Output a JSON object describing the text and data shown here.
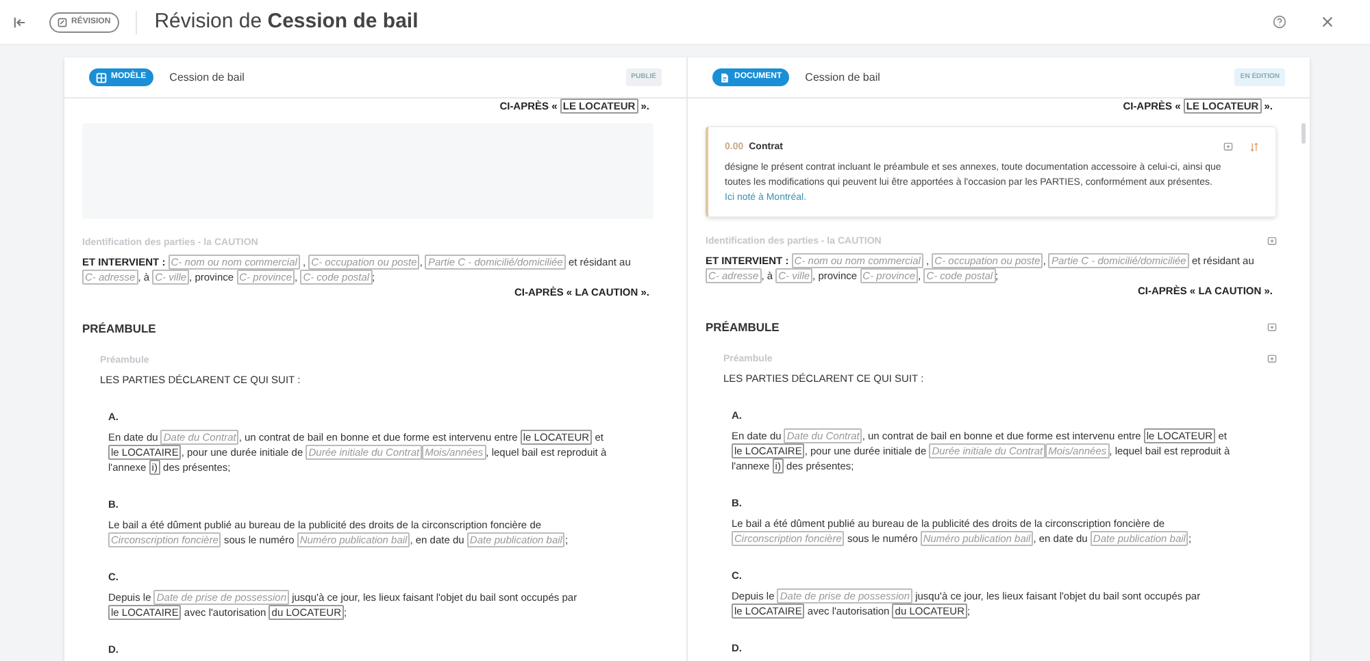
{
  "topbar": {
    "badge": "RÉVISION",
    "title": "Révision de **Cession de bail**"
  },
  "panels": [
    {
      "badge": {
        "label": "MODÈLE",
        "kind": "model"
      },
      "title": "Cession de bail",
      "status": {
        "label": "PUBLIÉ",
        "color": "#eef0f3"
      },
      "blocks": [
        {
          "kind": "closing",
          "parts": [
            {
              "kind": "bold",
              "text": "CI-APRÈS « "
            },
            {
              "kind": "ref",
              "text": "LE LOCATEUR"
            },
            {
              "kind": "bold",
              "text": " »."
            }
          ]
        },
        {
          "kind": "blank"
        },
        {
          "kind": "caption",
          "text": "Identification des parties - la CAUTION"
        },
        {
          "kind": "paragraph",
          "parts": [
            {
              "kind": "bold",
              "text": "ET INTERVIENT : "
            },
            {
              "kind": "field",
              "text": "C- nom ou nom commercial"
            },
            {
              "kind": "text",
              "text": " , "
            },
            {
              "kind": "field",
              "text": "C- occupation ou poste"
            },
            {
              "kind": "text",
              "text": ", "
            },
            {
              "kind": "field",
              "text": "Partie C - domicilié/domiciliée"
            },
            {
              "kind": "text",
              "text": " et résidant au "
            },
            {
              "kind": "field",
              "text": "C- adresse"
            },
            {
              "kind": "text",
              "text": ", à "
            },
            {
              "kind": "field",
              "text": "C- ville"
            },
            {
              "kind": "text",
              "text": ", province "
            },
            {
              "kind": "field",
              "text": "C- province"
            },
            {
              "kind": "text",
              "text": ", "
            },
            {
              "kind": "field",
              "text": "C- code postal"
            },
            {
              "kind": "text",
              "text": ";"
            }
          ]
        },
        {
          "kind": "closing",
          "parts": [
            {
              "kind": "bold",
              "text": "CI-APRÈS « LA CAUTION »."
            }
          ]
        },
        {
          "kind": "heading",
          "text": "PRÉAMBULE"
        },
        {
          "kind": "subcaption",
          "text": "Préambule"
        },
        {
          "kind": "intro",
          "text": "LES PARTIES DÉCLARENT CE QUI SUIT :"
        },
        {
          "kind": "clause_label",
          "text": "A."
        },
        {
          "kind": "clause",
          "parts": [
            {
              "kind": "text",
              "text": "En date du "
            },
            {
              "kind": "field",
              "text": "Date du Contrat"
            },
            {
              "kind": "text",
              "text": ", un contrat de bail en bonne et due forme est intervenu entre "
            },
            {
              "kind": "ref",
              "text": "le LOCATEUR"
            },
            {
              "kind": "text",
              "text": " et "
            },
            {
              "kind": "ref",
              "text": "le LOCATAIRE"
            },
            {
              "kind": "text",
              "text": ", pour une durée initiale de "
            },
            {
              "kind": "field",
              "text": "Durée initiale du Contrat"
            },
            {
              "kind": "field",
              "text": "Mois/années"
            },
            {
              "kind": "text",
              "text": ", lequel bail est reproduit à l'annexe "
            },
            {
              "kind": "ref",
              "text": "i)"
            },
            {
              "kind": "text",
              "text": " des présentes;"
            }
          ]
        },
        {
          "kind": "clause_label",
          "text": "B."
        },
        {
          "kind": "clause",
          "parts": [
            {
              "kind": "text",
              "text": "Le bail a été dûment publié au bureau de la publicité des droits de la circonscription foncière de "
            },
            {
              "kind": "field",
              "text": "Circonscription foncière"
            },
            {
              "kind": "text",
              "text": " sous le numéro "
            },
            {
              "kind": "field",
              "text": "Numéro publication bail"
            },
            {
              "kind": "text",
              "text": ", en date du "
            },
            {
              "kind": "field",
              "text": "Date publication bail"
            },
            {
              "kind": "text",
              "text": ";"
            }
          ]
        },
        {
          "kind": "clause_label",
          "text": "C."
        },
        {
          "kind": "clause",
          "parts": [
            {
              "kind": "text",
              "text": "Depuis le "
            },
            {
              "kind": "field",
              "text": "Date de prise de possession"
            },
            {
              "kind": "text",
              "text": " jusqu'à ce jour, les lieux faisant l'objet du bail sont occupés par "
            },
            {
              "kind": "ref",
              "text": "le LOCATAIRE"
            },
            {
              "kind": "text",
              "text": " avec l'autorisation "
            },
            {
              "kind": "ref",
              "text": "du LOCATEUR"
            },
            {
              "kind": "text",
              "text": ";"
            }
          ]
        },
        {
          "kind": "clause_label",
          "text": "D."
        }
      ]
    },
    {
      "badge": {
        "label": "DOCUMENT",
        "kind": "document"
      },
      "title": "Cession de bail",
      "status": {
        "label": "EN ÉDITION",
        "color": "#e6f3fb"
      },
      "blocks": [
        {
          "kind": "closing",
          "parts": [
            {
              "kind": "bold",
              "text": "CI-APRÈS « "
            },
            {
              "kind": "ref",
              "text": "LE LOCATEUR"
            },
            {
              "kind": "bold",
              "text": " »."
            }
          ]
        },
        {
          "kind": "definition",
          "number": "0.00",
          "title": "Contrat",
          "text": "désigne le présent contrat incluant le préambule et ses annexes, toute documentation accessoire à celui-ci, ainsi que toutes les modifications qui peuvent lui être apportées à l'occasion par les PARTIES, conformément aux présentes. ",
          "link": "Ici noté à Montréal."
        },
        {
          "kind": "caption",
          "text": "Identification des parties - la CAUTION",
          "action": true
        },
        {
          "kind": "paragraph",
          "parts": [
            {
              "kind": "bold",
              "text": "ET INTERVIENT : "
            },
            {
              "kind": "field",
              "text": "C- nom ou nom commercial"
            },
            {
              "kind": "text",
              "text": " , "
            },
            {
              "kind": "field",
              "text": "C- occupation ou poste"
            },
            {
              "kind": "text",
              "text": ", "
            },
            {
              "kind": "field",
              "text": "Partie C - domicilié/domiciliée"
            },
            {
              "kind": "text",
              "text": " et résidant au "
            },
            {
              "kind": "field",
              "text": "C- adresse"
            },
            {
              "kind": "text",
              "text": ", à "
            },
            {
              "kind": "field",
              "text": "C- ville"
            },
            {
              "kind": "text",
              "text": ", province "
            },
            {
              "kind": "field",
              "text": "C- province"
            },
            {
              "kind": "text",
              "text": ", "
            },
            {
              "kind": "field",
              "text": "C- code postal"
            },
            {
              "kind": "text",
              "text": ";"
            }
          ]
        },
        {
          "kind": "closing",
          "parts": [
            {
              "kind": "bold",
              "text": "CI-APRÈS « LA CAUTION »."
            }
          ]
        },
        {
          "kind": "heading",
          "text": "PRÉAMBULE",
          "action": true
        },
        {
          "kind": "subcaption",
          "text": "Préambule",
          "action": true
        },
        {
          "kind": "intro",
          "text": "LES PARTIES DÉCLARENT CE QUI SUIT :"
        },
        {
          "kind": "clause_label",
          "text": "A."
        },
        {
          "kind": "clause",
          "parts": [
            {
              "kind": "text",
              "text": "En date du "
            },
            {
              "kind": "field",
              "text": "Date du Contrat"
            },
            {
              "kind": "text",
              "text": ", un contrat de bail en bonne et due forme est intervenu entre "
            },
            {
              "kind": "ref",
              "text": "le LOCATEUR"
            },
            {
              "kind": "text",
              "text": " et "
            },
            {
              "kind": "ref",
              "text": "le LOCATAIRE"
            },
            {
              "kind": "text",
              "text": ", pour une durée initiale de "
            },
            {
              "kind": "field",
              "text": "Durée initiale du Contrat"
            },
            {
              "kind": "field",
              "text": "Mois/années"
            },
            {
              "kind": "text",
              "text": ", lequel bail est reproduit à l'annexe "
            },
            {
              "kind": "ref",
              "text": "i)"
            },
            {
              "kind": "text",
              "text": " des présentes;"
            }
          ]
        },
        {
          "kind": "clause_label",
          "text": "B."
        },
        {
          "kind": "clause",
          "parts": [
            {
              "kind": "text",
              "text": "Le bail a été dûment publié au bureau de la publicité des droits de la circonscription foncière de "
            },
            {
              "kind": "field",
              "text": "Circonscription foncière"
            },
            {
              "kind": "text",
              "text": " sous le numéro "
            },
            {
              "kind": "field",
              "text": "Numéro publication bail"
            },
            {
              "kind": "text",
              "text": ", en date du "
            },
            {
              "kind": "field",
              "text": "Date publication bail"
            },
            {
              "kind": "text",
              "text": ";"
            }
          ]
        },
        {
          "kind": "clause_label",
          "text": "C."
        },
        {
          "kind": "clause",
          "parts": [
            {
              "kind": "text",
              "text": "Depuis le "
            },
            {
              "kind": "field",
              "text": "Date de prise de possession"
            },
            {
              "kind": "text",
              "text": " jusqu'à ce jour, les lieux faisant l'objet du bail sont occupés par "
            },
            {
              "kind": "ref",
              "text": "le LOCATAIRE"
            },
            {
              "kind": "text",
              "text": " avec l'autorisation "
            },
            {
              "kind": "ref",
              "text": "du LOCATEUR"
            },
            {
              "kind": "text",
              "text": ";"
            }
          ]
        },
        {
          "kind": "clause_label",
          "text": "D."
        }
      ]
    }
  ]
}
